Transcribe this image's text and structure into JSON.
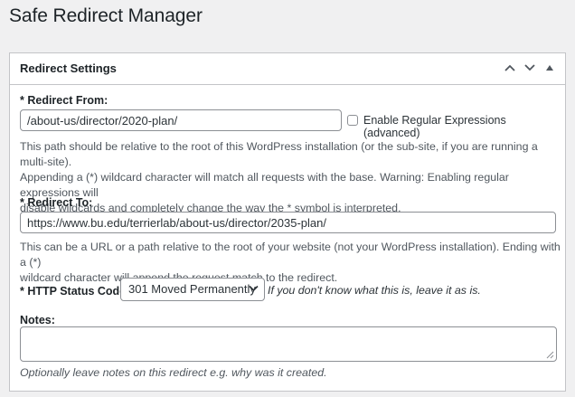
{
  "page": {
    "title": "Safe Redirect Manager"
  },
  "box": {
    "title": "Redirect Settings",
    "actions": {
      "up_icon": "chevron-up-icon",
      "down_icon": "chevron-down-icon",
      "toggle_icon": "triangle-up-icon"
    }
  },
  "redirect_from": {
    "label": "* Redirect From:",
    "value": "/about-us/director/2020-plan/",
    "regex_checkbox": {
      "label": "Enable Regular Expressions (advanced)",
      "checked": false
    },
    "description": [
      "This path should be relative to the root of this WordPress installation (or the sub-site, if you are running a multi-site).",
      "Appending a (*) wildcard character will match all requests with the base. Warning: Enabling regular expressions will",
      "disable wildcards and completely change the way the * symbol is interpreted."
    ]
  },
  "redirect_to": {
    "label": "* Redirect To:",
    "value": "https://www.bu.edu/terrierlab/about-us/director/2035-plan/",
    "description": [
      "This can be a URL or a path relative to the root of your website (not your WordPress installation). Ending with a (*)",
      "wildcard character will append the request match to the redirect."
    ]
  },
  "status_code": {
    "label": "* HTTP Status Code:",
    "selected": "301 Moved Permanently",
    "hint": "If you don't know what this is, leave it as is."
  },
  "notes": {
    "label": "Notes:",
    "value": "",
    "description": "Optionally leave notes on this redirect e.g. why was it created."
  }
}
